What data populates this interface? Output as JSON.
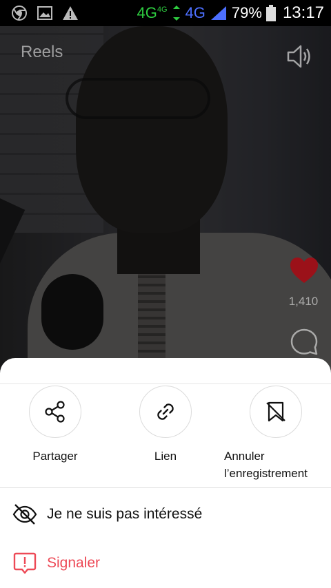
{
  "status_bar": {
    "net1": "4G",
    "net1_small": "4G",
    "net2": "4G",
    "battery": "79%",
    "time": "13:17",
    "icons": [
      "chrome-icon",
      "image-icon",
      "warning-icon",
      "signal-icon",
      "battery-icon"
    ]
  },
  "video": {
    "title": "Reels",
    "likes": "1,410",
    "icons": [
      "volume-icon",
      "heart-icon",
      "comment-icon"
    ],
    "heart_color": "#c0151f"
  },
  "sheet": {
    "actions": [
      {
        "label": "Partager",
        "icon": "share-icon"
      },
      {
        "label": "Lien",
        "icon": "link-icon"
      },
      {
        "label": "Annuler l’enregistrement",
        "icon": "unsave-icon"
      }
    ],
    "menu": [
      {
        "label": "Je ne suis pas intéressé",
        "icon": "eye-off-icon"
      },
      {
        "label": "Signaler",
        "icon": "report-icon",
        "color": "#ed4956"
      }
    ]
  }
}
